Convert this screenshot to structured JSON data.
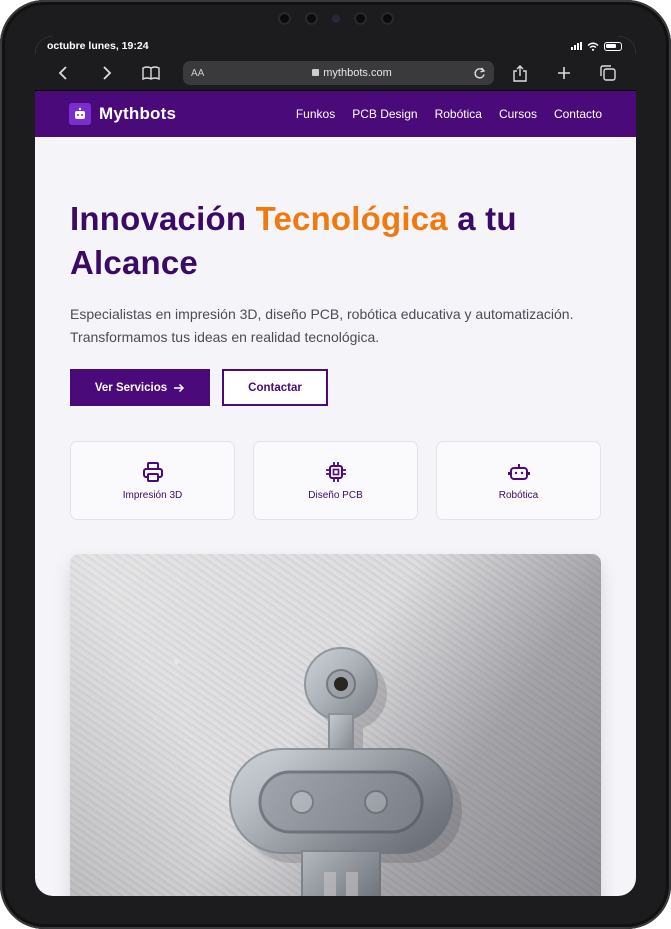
{
  "status_bar": {
    "time": "octubre lunes, 19:24"
  },
  "browser": {
    "text_size_label": "AA",
    "url": "mythbots.com"
  },
  "site": {
    "brand": "Mythbots",
    "nav": [
      "Funkos",
      "PCB Design",
      "Robótica",
      "Cursos",
      "Contacto"
    ]
  },
  "hero": {
    "title_part1": "Innovación ",
    "title_accent": "Tecnológica",
    "title_part2": " a tu Alcance",
    "lead": "Especialistas en impresión 3D, diseño PCB, robótica educativa y automatización. Transformamos tus ideas en realidad tecnológica.",
    "primary_button": "Ver Servicios",
    "secondary_button": "Contactar"
  },
  "services": [
    {
      "label": "Impresión 3D",
      "icon": "printer-icon"
    },
    {
      "label": "Diseño PCB",
      "icon": "chip-icon"
    },
    {
      "label": "Robótica",
      "icon": "robot-icon"
    }
  ],
  "colors": {
    "brand_purple": "#4a0a7a",
    "accent_orange": "#f07a12",
    "heading_purple": "#3a0a66"
  }
}
